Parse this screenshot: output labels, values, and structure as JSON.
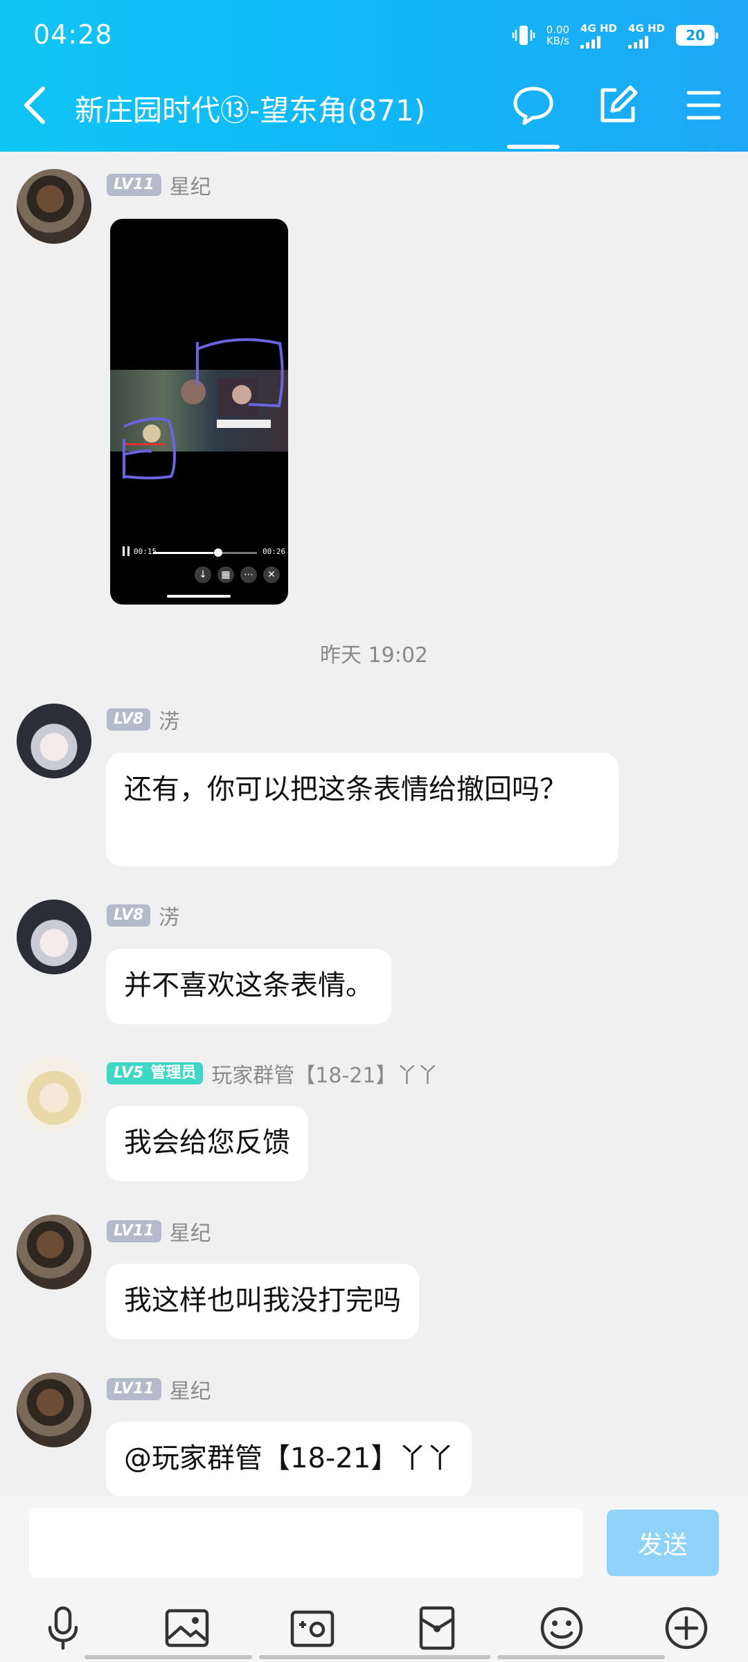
{
  "status": {
    "time": "04:28",
    "speed_value": "0.00",
    "speed_unit": "KB/s",
    "network1": "4G HD",
    "network2": "4G HD",
    "battery": "20"
  },
  "header": {
    "title": "新庄园时代⑬-望东角(871)",
    "icons": [
      "back-icon",
      "chat-bubble-icon",
      "edit-icon",
      "menu-icon"
    ]
  },
  "video": {
    "current_time": "00:15",
    "total_time": "00:26",
    "progress_percent": 58
  },
  "timestamp": "昨天 19:02",
  "messages": [
    {
      "level": "LV11",
      "name": "星纪",
      "text": ""
    },
    {
      "level": "LV8",
      "name": "淓",
      "text": "还有，你可以把这条表情给撤回吗？"
    },
    {
      "level": "LV8",
      "name": "淓",
      "text": "并不喜欢这条表情。"
    },
    {
      "level": "LV5",
      "badge": "管理员",
      "name": "玩家群管【18-21】丫丫",
      "text": "我会给您反馈"
    },
    {
      "level": "LV11",
      "name": "星纪",
      "text": "我这样也叫我没打完吗"
    },
    {
      "level": "LV11",
      "name": "星纪",
      "text": "@玩家群管【18-21】丫丫"
    }
  ],
  "input": {
    "placeholder": "",
    "send_label": "发送"
  },
  "toolbar": [
    "microphone-icon",
    "image-icon",
    "camera-icon",
    "red-packet-icon",
    "emoji-icon",
    "plus-icon"
  ],
  "colors": {
    "header_start": "#0fc5f5",
    "header_end": "#1ea8f7",
    "send_button": "#8fd3fb",
    "level_badge": "#b3bac9",
    "admin_badge": "#3ed7c6"
  }
}
